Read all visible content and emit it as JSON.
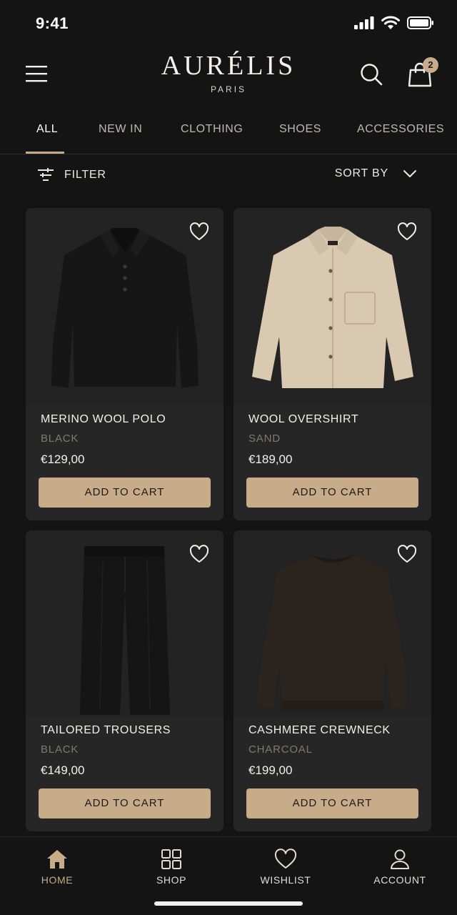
{
  "status_bar": {
    "time": "9:41"
  },
  "header": {
    "brand": "AURÉLIS",
    "brand_sub": "PARIS",
    "cart_count": "2"
  },
  "tabs": [
    {
      "label": "ALL",
      "active": true
    },
    {
      "label": "NEW IN"
    },
    {
      "label": "CLOTHING"
    },
    {
      "label": "SHOES"
    },
    {
      "label": "ACCESSORIES"
    }
  ],
  "toolbar": {
    "filter_label": "FILTER",
    "sort_label": "SORT BY"
  },
  "products": [
    {
      "name": "MERINO WOOL POLO",
      "color": "BLACK",
      "price": "€129,00",
      "button": "ADD TO CART"
    },
    {
      "name": "WOOL OVERSHIRT",
      "color": "SAND",
      "price": "€189,00",
      "button": "ADD TO CART"
    },
    {
      "name": "TAILORED TROUSERS",
      "color": "BLACK",
      "price": "€149,00",
      "button": "ADD TO CART"
    },
    {
      "name": "CASHMERE CREWNECK",
      "color": "CHARCOAL",
      "price": "€199,00",
      "button": "ADD TO CART"
    }
  ],
  "bottom_nav": [
    {
      "label": "HOME",
      "icon": "home-icon",
      "active": true
    },
    {
      "label": "SHOP",
      "icon": "grid-icon"
    },
    {
      "label": "WISHLIST",
      "icon": "heart-icon"
    },
    {
      "label": "ACCOUNT",
      "icon": "user-icon"
    }
  ],
  "colors": {
    "accent": "#c8ab88",
    "background": "#141414",
    "card": "#262626"
  }
}
